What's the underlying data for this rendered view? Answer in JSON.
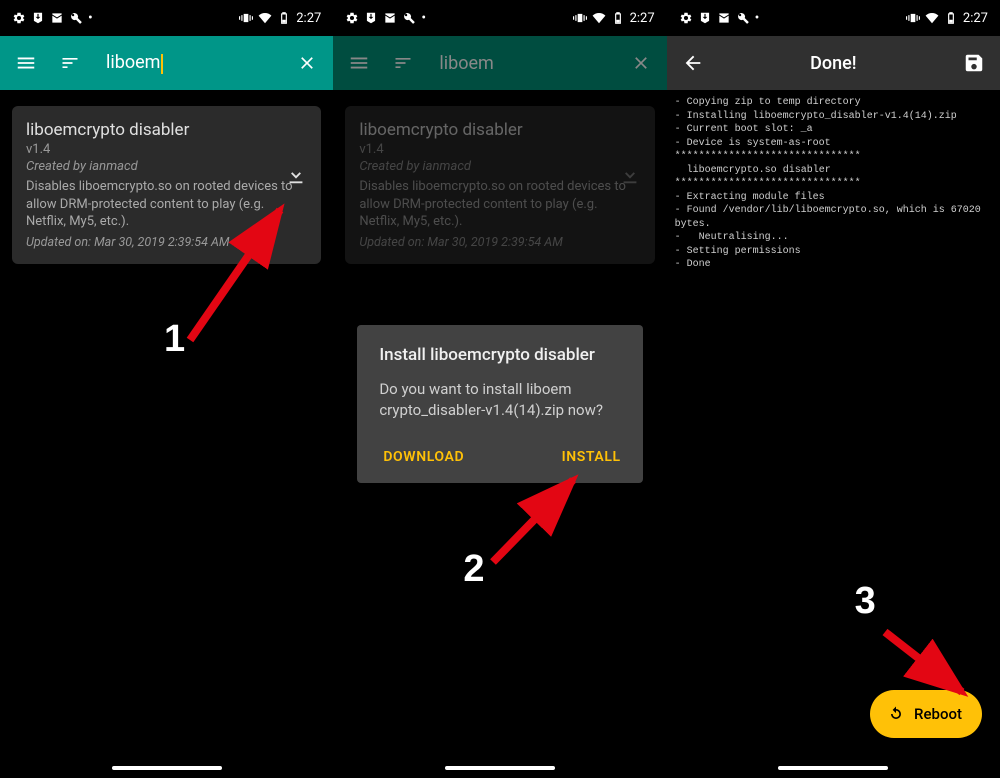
{
  "status": {
    "time": "2:27"
  },
  "search": {
    "query": "liboem"
  },
  "module": {
    "title": "liboemcrypto disabler",
    "version": "v1.4",
    "author": "Created by ianmacd",
    "desc": "Disables liboemcrypto.so on rooted devices to allow DRM-protected content to play (e.g. Netflix, My5, etc.).",
    "updated": "Updated on: Mar 30, 2019 2:39:54 AM"
  },
  "dialog": {
    "title": "Install liboemcrypto disabler",
    "message": "Do you want to install liboem crypto_disabler-v1.4(14).zip now?",
    "download": "DOWNLOAD",
    "install": "INSTALL"
  },
  "done": {
    "title": "Done!",
    "log": "- Copying zip to temp directory\n- Installing liboemcrypto_disabler-v1.4(14).zip\n- Current boot slot: _a\n- Device is system-as-root\n*******************************\n  liboemcrypto.so disabler\n*******************************\n- Extracting module files\n- Found /vendor/lib/liboemcrypto.so, which is 67020 bytes.\n-   Neutralising...\n- Setting permissions\n- Done"
  },
  "fab": {
    "label": "Reboot"
  },
  "annotations": {
    "n1": "1",
    "n2": "2",
    "n3": "3"
  }
}
